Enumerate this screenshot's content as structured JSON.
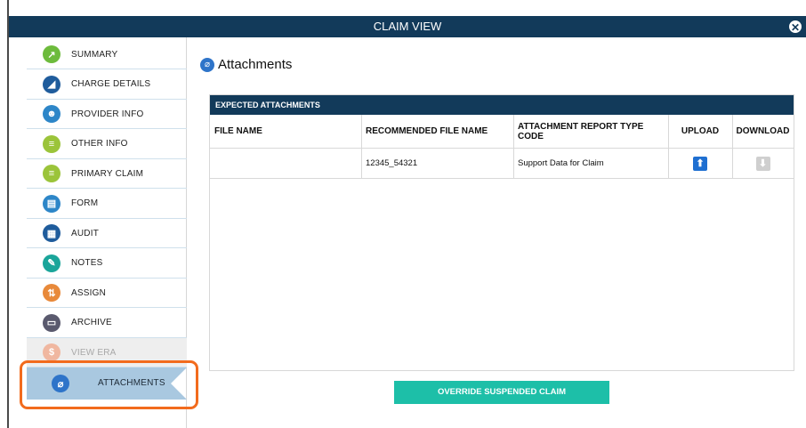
{
  "window": {
    "title": "CLAIM VIEW",
    "close_glyph": "✕"
  },
  "sidebar": {
    "items": [
      {
        "label": "SUMMARY",
        "icon": "chart-icon",
        "color": "#6dbb3c",
        "glyph": "↗"
      },
      {
        "label": "CHARGE DETAILS",
        "icon": "megaphone-icon",
        "color": "#1f5c9c",
        "glyph": "◢"
      },
      {
        "label": "PROVIDER INFO",
        "icon": "provider-icon",
        "color": "#2d86c8",
        "glyph": "☻"
      },
      {
        "label": "OTHER INFO",
        "icon": "document-icon",
        "color": "#9bc43a",
        "glyph": "≡"
      },
      {
        "label": "PRIMARY CLAIM",
        "icon": "document-icon",
        "color": "#9bc43a",
        "glyph": "≡"
      },
      {
        "label": "FORM",
        "icon": "form-icon",
        "color": "#2d86c8",
        "glyph": "▤"
      },
      {
        "label": "AUDIT",
        "icon": "calculator-icon",
        "color": "#1f5c9c",
        "glyph": "▦"
      },
      {
        "label": "NOTES",
        "icon": "notes-icon",
        "color": "#1aa59a",
        "glyph": "✎"
      },
      {
        "label": "ASSIGN",
        "icon": "assign-icon",
        "color": "#e8893a",
        "glyph": "⇅"
      },
      {
        "label": "ARCHIVE",
        "icon": "archive-icon",
        "color": "#5a5a6e",
        "glyph": "▭"
      },
      {
        "label": "VIEW ERA",
        "icon": "era-icon",
        "color": "#f0b7a0",
        "glyph": "$",
        "disabled": true
      }
    ],
    "active": {
      "label": "ATTACHMENTS",
      "icon": "paperclip-icon",
      "color": "#2e74c9",
      "glyph": "⌀"
    }
  },
  "main": {
    "title": "Attachments",
    "panel": {
      "header": "EXPECTED ATTACHMENTS",
      "columns": [
        "FILE NAME",
        "RECOMMENDED FILE NAME",
        "ATTACHMENT REPORT TYPE CODE",
        "UPLOAD",
        "DOWNLOAD"
      ],
      "rows": [
        {
          "file_name": "",
          "recommended_file_name": "12345_54321",
          "report_type_code": "Support Data for Claim"
        }
      ]
    },
    "override_button": "OVERRIDE SUSPENDED CLAIM"
  },
  "colors": {
    "titlebar": "#123a5a",
    "accent_teal": "#1dbfa8",
    "highlight_orange": "#f26b1d",
    "upload_blue": "#1f6fd1"
  }
}
